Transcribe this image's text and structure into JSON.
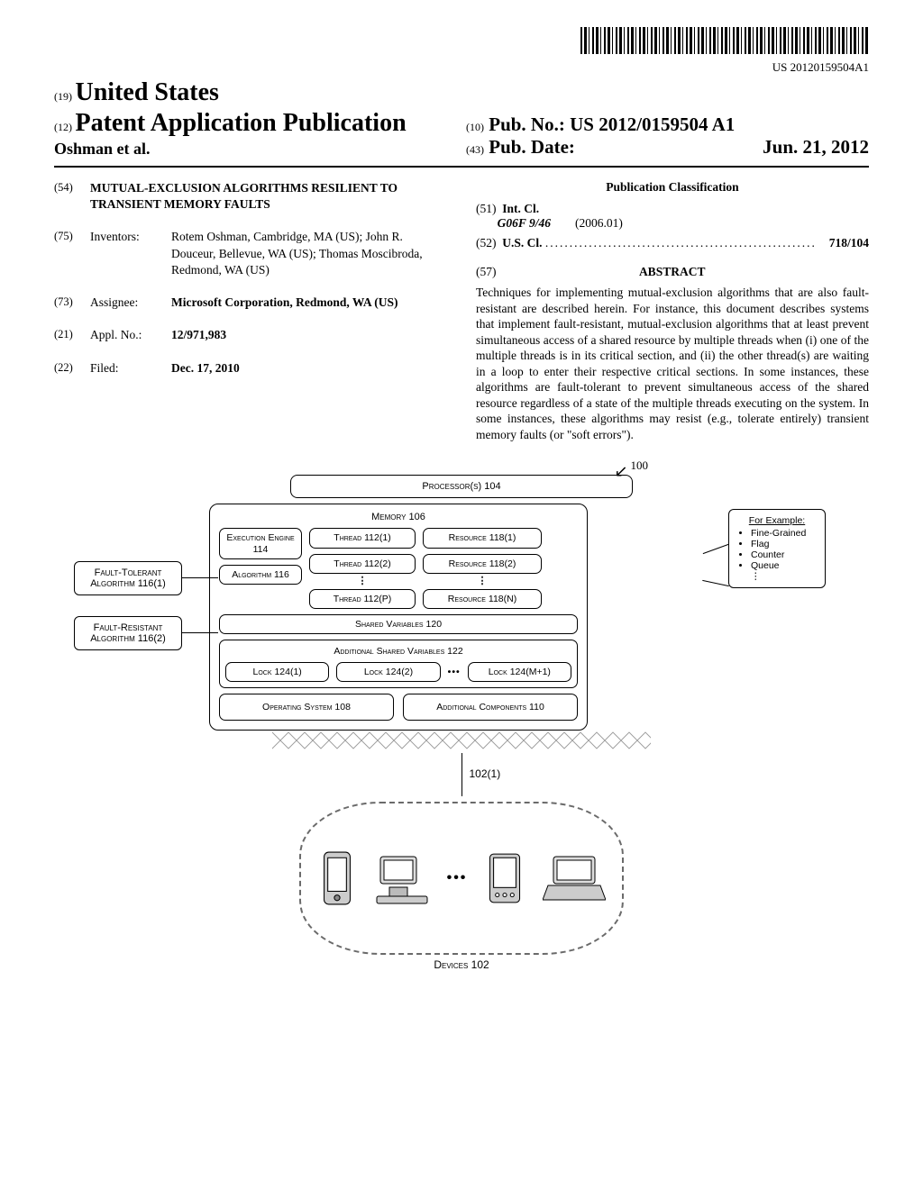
{
  "barcode_label": "US 20120159504A1",
  "header": {
    "code19": "(19)",
    "country": "United States",
    "code12": "(12)",
    "pub_type": "Patent Application Publication",
    "authors_line": "Oshman et al.",
    "code10": "(10)",
    "pub_no_label": "Pub. No.:",
    "pub_no": "US 2012/0159504 A1",
    "code43": "(43)",
    "pub_date_label": "Pub. Date:",
    "pub_date": "Jun. 21, 2012"
  },
  "left": {
    "f54": {
      "code": "(54)",
      "title": "MUTUAL-EXCLUSION ALGORITHMS RESILIENT TO TRANSIENT MEMORY FAULTS"
    },
    "f75": {
      "code": "(75)",
      "label": "Inventors:",
      "value": "Rotem Oshman, Cambridge, MA (US); John R. Douceur, Bellevue, WA (US); Thomas Moscibroda, Redmond, WA (US)"
    },
    "f73": {
      "code": "(73)",
      "label": "Assignee:",
      "value": "Microsoft Corporation, Redmond, WA (US)"
    },
    "f21": {
      "code": "(21)",
      "label": "Appl. No.:",
      "value": "12/971,983"
    },
    "f22": {
      "code": "(22)",
      "label": "Filed:",
      "value": "Dec. 17, 2010"
    }
  },
  "right": {
    "pc_head": "Publication Classification",
    "f51": {
      "code": "(51)",
      "label": "Int. Cl.",
      "cls": "G06F 9/46",
      "date": "(2006.01)"
    },
    "f52": {
      "code": "(52)",
      "label": "U.S. Cl.",
      "dots": "........................................................",
      "value": "718/104"
    },
    "f57": {
      "code": "(57)",
      "label": "ABSTRACT"
    },
    "abstract": "Techniques for implementing mutual-exclusion algorithms that are also fault-resistant are described herein. For instance, this document describes systems that implement fault-resistant, mutual-exclusion algorithms that at least prevent simultaneous access of a shared resource by multiple threads when (i) one of the multiple threads is in its critical section, and (ii) the other thread(s) are waiting in a loop to enter their respective critical sections. In some instances, these algorithms are fault-tolerant to prevent simultaneous access of the shared resource regardless of a state of the multiple threads executing on the system. In some instances, these algorithms may resist (e.g., tolerate entirely) transient memory faults (or \"soft errors\")."
  },
  "fig": {
    "ref100": "100",
    "processors": "Processor(s) 104",
    "memory": "Memory 106",
    "exec": "Execution Engine 114",
    "algo": "Algorithm 116",
    "threads": [
      "Thread 112(1)",
      "Thread 112(2)",
      "Thread 112(P)"
    ],
    "resources": [
      "Resource 118(1)",
      "Resource 118(2)",
      "Resource 118(N)"
    ],
    "shared": "Shared Variables 120",
    "addl_shared": "Additional Shared Variables 122",
    "locks": [
      "Lock 124(1)",
      "Lock 124(2)",
      "Lock 124(M+1)"
    ],
    "os": "Operating System 108",
    "addl_comp": "Additional Components 110",
    "ft": "Fault-Tolerant Algorithm 116(1)",
    "fr": "Fault-Resistant Algorithm 116(2)",
    "example_head": "For Example:",
    "example_items": [
      "Fine-Grained",
      "Flag",
      "Counter",
      "Queue",
      "⋮"
    ],
    "lead_label": "102(1)",
    "devices_label": "Devices 102"
  }
}
